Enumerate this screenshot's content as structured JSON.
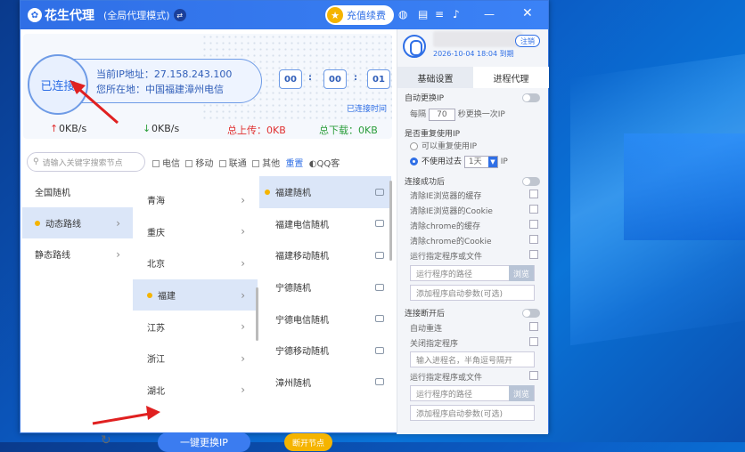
{
  "app": {
    "title": "花生代理",
    "mode": "(全局代理模式)",
    "recharge_label": "充值续费"
  },
  "status": {
    "connect_label": "已连接",
    "ip_label": "当前IP地址：27.158.243.100",
    "loc_label": "您所在地：中国福建漳州电信",
    "timer": [
      "00",
      "00",
      "01"
    ],
    "timer_caption": "已连接时间",
    "down_speed": "0KB/s",
    "up_speed": "0KB/s",
    "total_upload": "总上传：0KB",
    "total_download": "总下载：0KB"
  },
  "search": {
    "placeholder": "请输入关键字搜索节点"
  },
  "filters": {
    "items": [
      "电信",
      "移动",
      "联通",
      "其他"
    ],
    "reset": "重置",
    "qq": "QQ客"
  },
  "col1": [
    {
      "label": "全国随机"
    },
    {
      "label": "动态路线"
    },
    {
      "label": "静态路线"
    }
  ],
  "col2": [
    {
      "label": "青海"
    },
    {
      "label": "重庆"
    },
    {
      "label": "北京"
    },
    {
      "label": "福建"
    },
    {
      "label": "江苏"
    },
    {
      "label": "浙江"
    },
    {
      "label": "湖北"
    }
  ],
  "col3": [
    {
      "label": "福建随机"
    },
    {
      "label": "福建电信随机"
    },
    {
      "label": "福建移动随机"
    },
    {
      "label": "宁德随机"
    },
    {
      "label": "宁德电信随机"
    },
    {
      "label": "宁德移动随机"
    },
    {
      "label": "漳州随机"
    }
  ],
  "bottom": {
    "switch_label": "一键更换IP",
    "disconnect_label": "断开节点"
  },
  "account": {
    "logout": "注销",
    "expire": "2026-10-04 18:04 到期"
  },
  "tabs": [
    {
      "label": "基础设置"
    },
    {
      "label": "进程代理"
    }
  ],
  "settings": {
    "auto_change": "自动更换IP",
    "every": "每隔",
    "every_value": "70",
    "every_unit": "秒更换一次IP",
    "reuse": "是否重复使用IP",
    "reuse_yes": "可以重复使用IP",
    "reuse_no": "不使用过去",
    "reuse_days": "1天",
    "reuse_unit": "IP",
    "on_success": "连接成功后",
    "clear_ie_cache": "清除IE浏览器的缓存",
    "clear_ie_cookie": "清除IE浏览器的Cookie",
    "clear_chrome_cache": "清除chrome的缓存",
    "clear_chrome_cookie": "清除chrome的Cookie",
    "run_program": "运行指定程序或文件",
    "path_placeholder": "运行程序的路径",
    "browse": "浏览",
    "args_placeholder": "添加程序启动参数(可选)",
    "on_disconnect": "连接断开后",
    "auto_reconnect": "自动重连",
    "close_program": "关闭指定程序",
    "process_placeholder": "输入进程名，半角逗号隔开",
    "run_program2": "运行指定程序或文件",
    "path_placeholder2": "运行程序的路径",
    "browse2": "浏览",
    "args_placeholder2": "添加程序启动参数(可选)"
  },
  "colors": {
    "accent": "#2f6fe6",
    "gold": "#f5b400",
    "arrow": "#e02020"
  }
}
